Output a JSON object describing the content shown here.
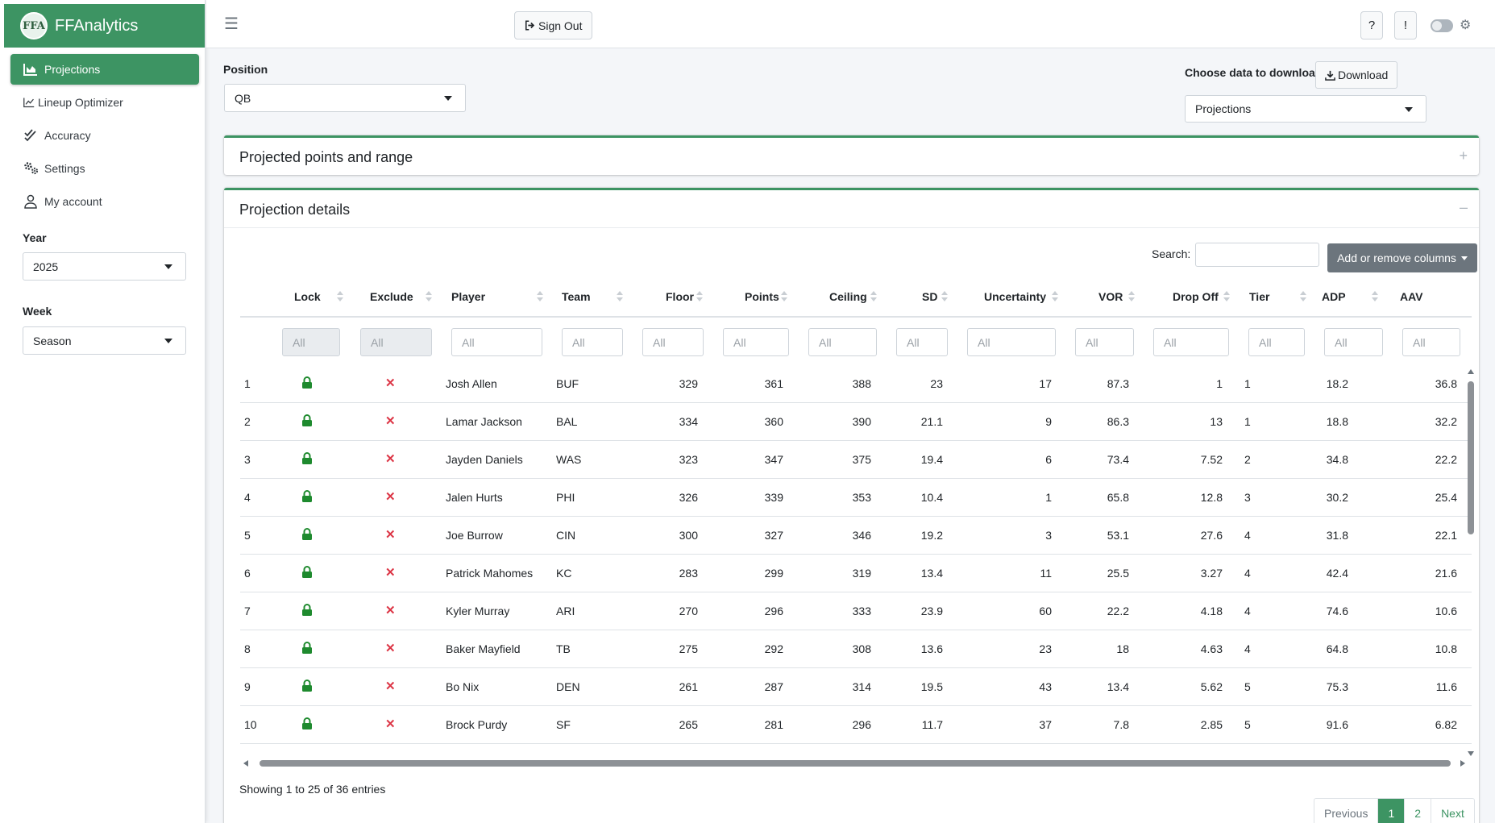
{
  "brand": {
    "title": "FFAnalytics",
    "logo_text": "FFA"
  },
  "sidebar": {
    "items": [
      {
        "label": "Projections",
        "icon": "chart-area-icon",
        "active": true
      },
      {
        "label": "Lineup Optimizer",
        "icon": "chart-line-icon"
      },
      {
        "label": "Accuracy",
        "icon": "check-double-icon"
      },
      {
        "label": "Settings",
        "icon": "gears-icon"
      },
      {
        "label": "My account",
        "icon": "user-icon"
      }
    ],
    "year_label": "Year",
    "year_value": "2025",
    "week_label": "Week",
    "week_value": "Season"
  },
  "header": {
    "sign_out_label": "Sign Out",
    "help_label": "?",
    "alert_label": "!"
  },
  "position": {
    "label": "Position",
    "value": "QB"
  },
  "download": {
    "label": "Choose data to download",
    "button_label": "Download",
    "select_value": "Projections"
  },
  "cards": {
    "range_title": "Projected points and range",
    "range_tool": "+",
    "details_title": "Projection details",
    "details_tool": "–"
  },
  "table": {
    "search_label": "Search:",
    "columns_button": "Add or remove columns",
    "columns": [
      "Lock",
      "Exclude",
      "Player",
      "Team",
      "Floor",
      "Points",
      "Ceiling",
      "SD",
      "Uncertainty",
      "VOR",
      "Drop Off",
      "Tier",
      "ADP",
      "AAV"
    ],
    "filter_placeholder": "All",
    "rows": [
      {
        "n": "1",
        "player": "Josh Allen",
        "team": "BUF",
        "floor": "329",
        "points": "361",
        "ceiling": "388",
        "sd": "23",
        "unc": "17",
        "vor": "87.3",
        "drop": "1",
        "tier": "1",
        "adp": "18.2",
        "aav": "36.8"
      },
      {
        "n": "2",
        "player": "Lamar Jackson",
        "team": "BAL",
        "floor": "334",
        "points": "360",
        "ceiling": "390",
        "sd": "21.1",
        "unc": "9",
        "vor": "86.3",
        "drop": "13",
        "tier": "1",
        "adp": "18.8",
        "aav": "32.2"
      },
      {
        "n": "3",
        "player": "Jayden Daniels",
        "team": "WAS",
        "floor": "323",
        "points": "347",
        "ceiling": "375",
        "sd": "19.4",
        "unc": "6",
        "vor": "73.4",
        "drop": "7.52",
        "tier": "2",
        "adp": "34.8",
        "aav": "22.2"
      },
      {
        "n": "4",
        "player": "Jalen Hurts",
        "team": "PHI",
        "floor": "326",
        "points": "339",
        "ceiling": "353",
        "sd": "10.4",
        "unc": "1",
        "vor": "65.8",
        "drop": "12.8",
        "tier": "3",
        "adp": "30.2",
        "aav": "25.4"
      },
      {
        "n": "5",
        "player": "Joe Burrow",
        "team": "CIN",
        "floor": "300",
        "points": "327",
        "ceiling": "346",
        "sd": "19.2",
        "unc": "3",
        "vor": "53.1",
        "drop": "27.6",
        "tier": "4",
        "adp": "31.8",
        "aav": "22.1"
      },
      {
        "n": "6",
        "player": "Patrick Mahomes",
        "team": "KC",
        "floor": "283",
        "points": "299",
        "ceiling": "319",
        "sd": "13.4",
        "unc": "11",
        "vor": "25.5",
        "drop": "3.27",
        "tier": "4",
        "adp": "42.4",
        "aav": "21.6"
      },
      {
        "n": "7",
        "player": "Kyler Murray",
        "team": "ARI",
        "floor": "270",
        "points": "296",
        "ceiling": "333",
        "sd": "23.9",
        "unc": "60",
        "vor": "22.2",
        "drop": "4.18",
        "tier": "4",
        "adp": "74.6",
        "aav": "10.6"
      },
      {
        "n": "8",
        "player": "Baker Mayfield",
        "team": "TB",
        "floor": "275",
        "points": "292",
        "ceiling": "308",
        "sd": "13.6",
        "unc": "23",
        "vor": "18",
        "drop": "4.63",
        "tier": "4",
        "adp": "64.8",
        "aav": "10.8"
      },
      {
        "n": "9",
        "player": "Bo Nix",
        "team": "DEN",
        "floor": "261",
        "points": "287",
        "ceiling": "314",
        "sd": "19.5",
        "unc": "43",
        "vor": "13.4",
        "drop": "5.62",
        "tier": "5",
        "adp": "75.3",
        "aav": "11.6"
      },
      {
        "n": "10",
        "player": "Brock Purdy",
        "team": "SF",
        "floor": "265",
        "points": "281",
        "ceiling": "296",
        "sd": "11.7",
        "unc": "37",
        "vor": "7.8",
        "drop": "2.85",
        "tier": "5",
        "adp": "91.6",
        "aav": "6.82"
      }
    ],
    "info": "Showing 1 to 25 of 36 entries",
    "pager": {
      "previous": "Previous",
      "pages": [
        "1",
        "2"
      ],
      "next": "Next",
      "current": "1"
    }
  },
  "colors": {
    "accent": "#3d9463",
    "lock": "#1e8a2e",
    "exclude": "#dc3545"
  }
}
